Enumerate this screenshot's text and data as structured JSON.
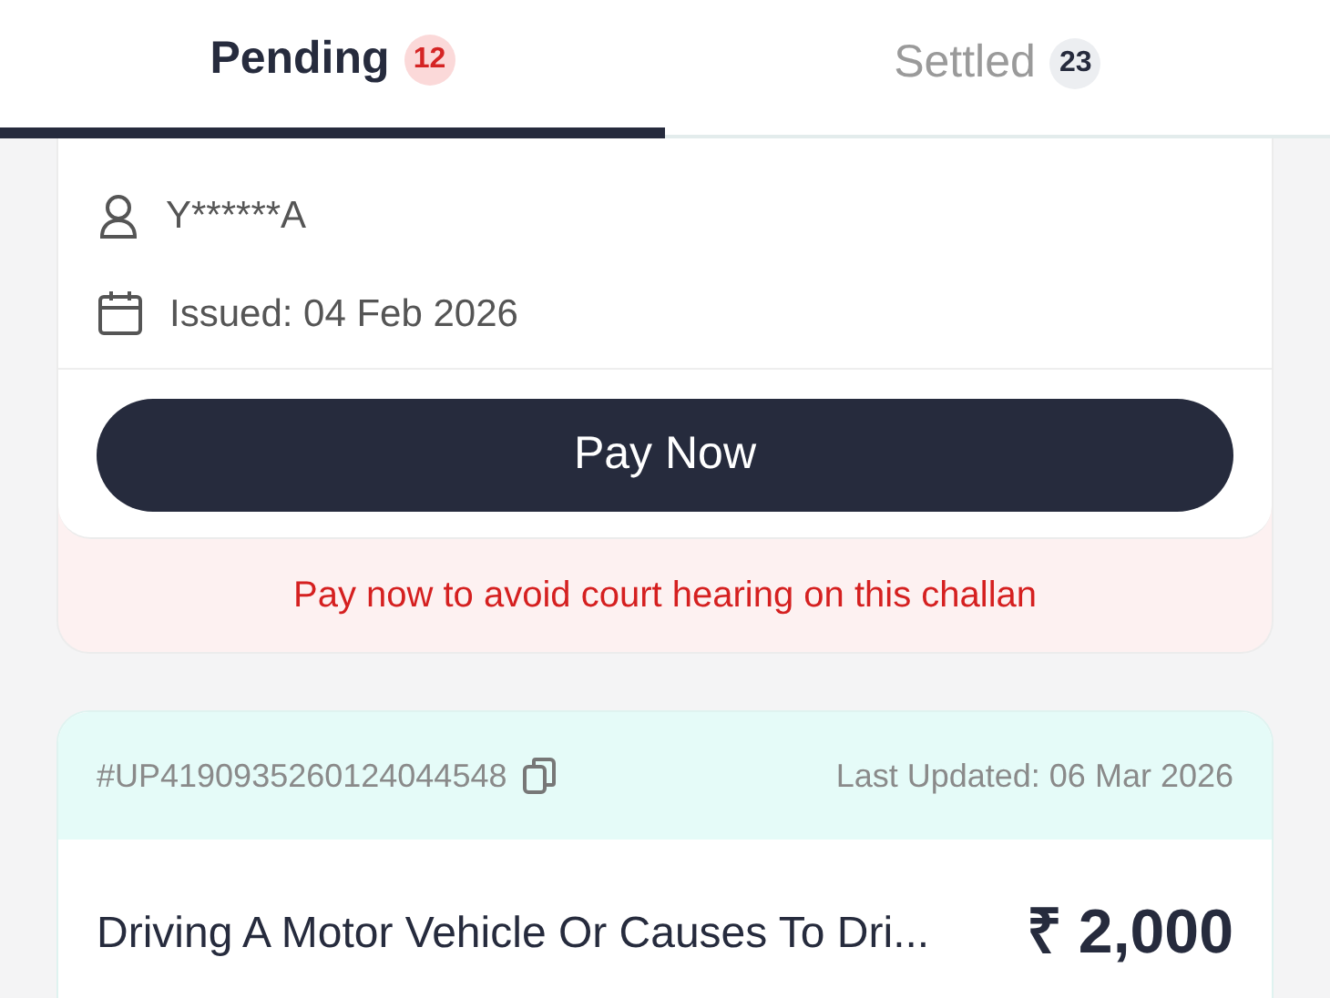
{
  "tabs": [
    {
      "label": "Pending",
      "count": "12",
      "selected": true
    },
    {
      "label": "Settled",
      "count": "23",
      "selected": false
    }
  ],
  "challans": [
    {
      "owner": "Y******A",
      "issued": "Issued: 04 Feb 2026",
      "action": "Pay Now",
      "warning": "Pay now to avoid court hearing on this challan"
    },
    {
      "challan_id": "#UP4190935260124044548",
      "last_updated": "Last Updated: 06 Mar 2026",
      "title": "Driving A Motor Vehicle Or Causes To Dri...",
      "amount": "₹ 2,000"
    }
  ]
}
